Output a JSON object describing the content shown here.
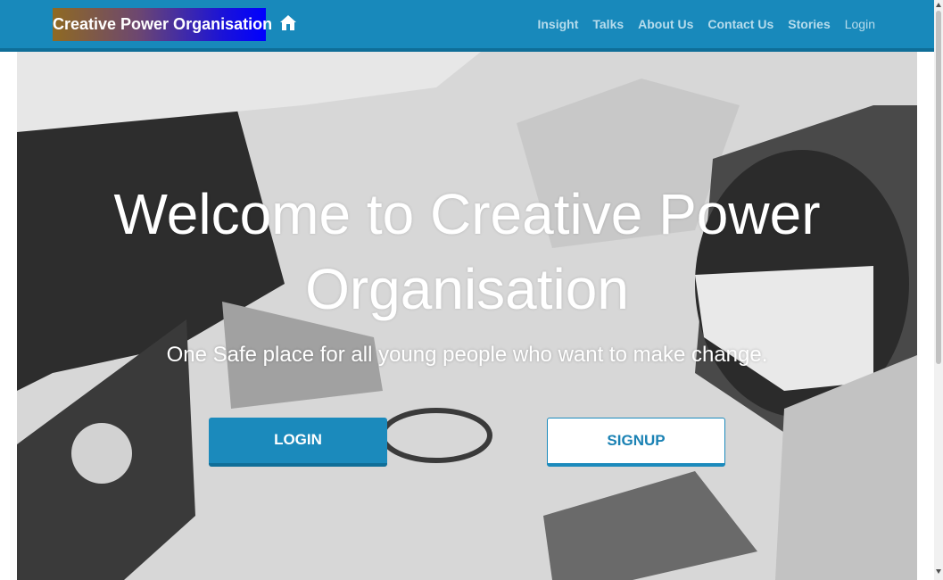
{
  "navbar": {
    "brand": "Creative Power Organisation",
    "home_icon": "home-icon",
    "links": [
      {
        "label": "Insight"
      },
      {
        "label": "Talks"
      },
      {
        "label": "About Us"
      },
      {
        "label": "Contact Us"
      },
      {
        "label": "Stories"
      },
      {
        "label": "Login"
      }
    ]
  },
  "hero": {
    "title": "Welcome to Creative Power Organisation",
    "subtitle": "One Safe place for all young people who want to make change.",
    "login_label": "LOGIN",
    "signup_label": "SIGNUP"
  },
  "colors": {
    "navbar": "#1889bb",
    "accent": "#1b8abc",
    "nav_link": "#b7dcec"
  }
}
